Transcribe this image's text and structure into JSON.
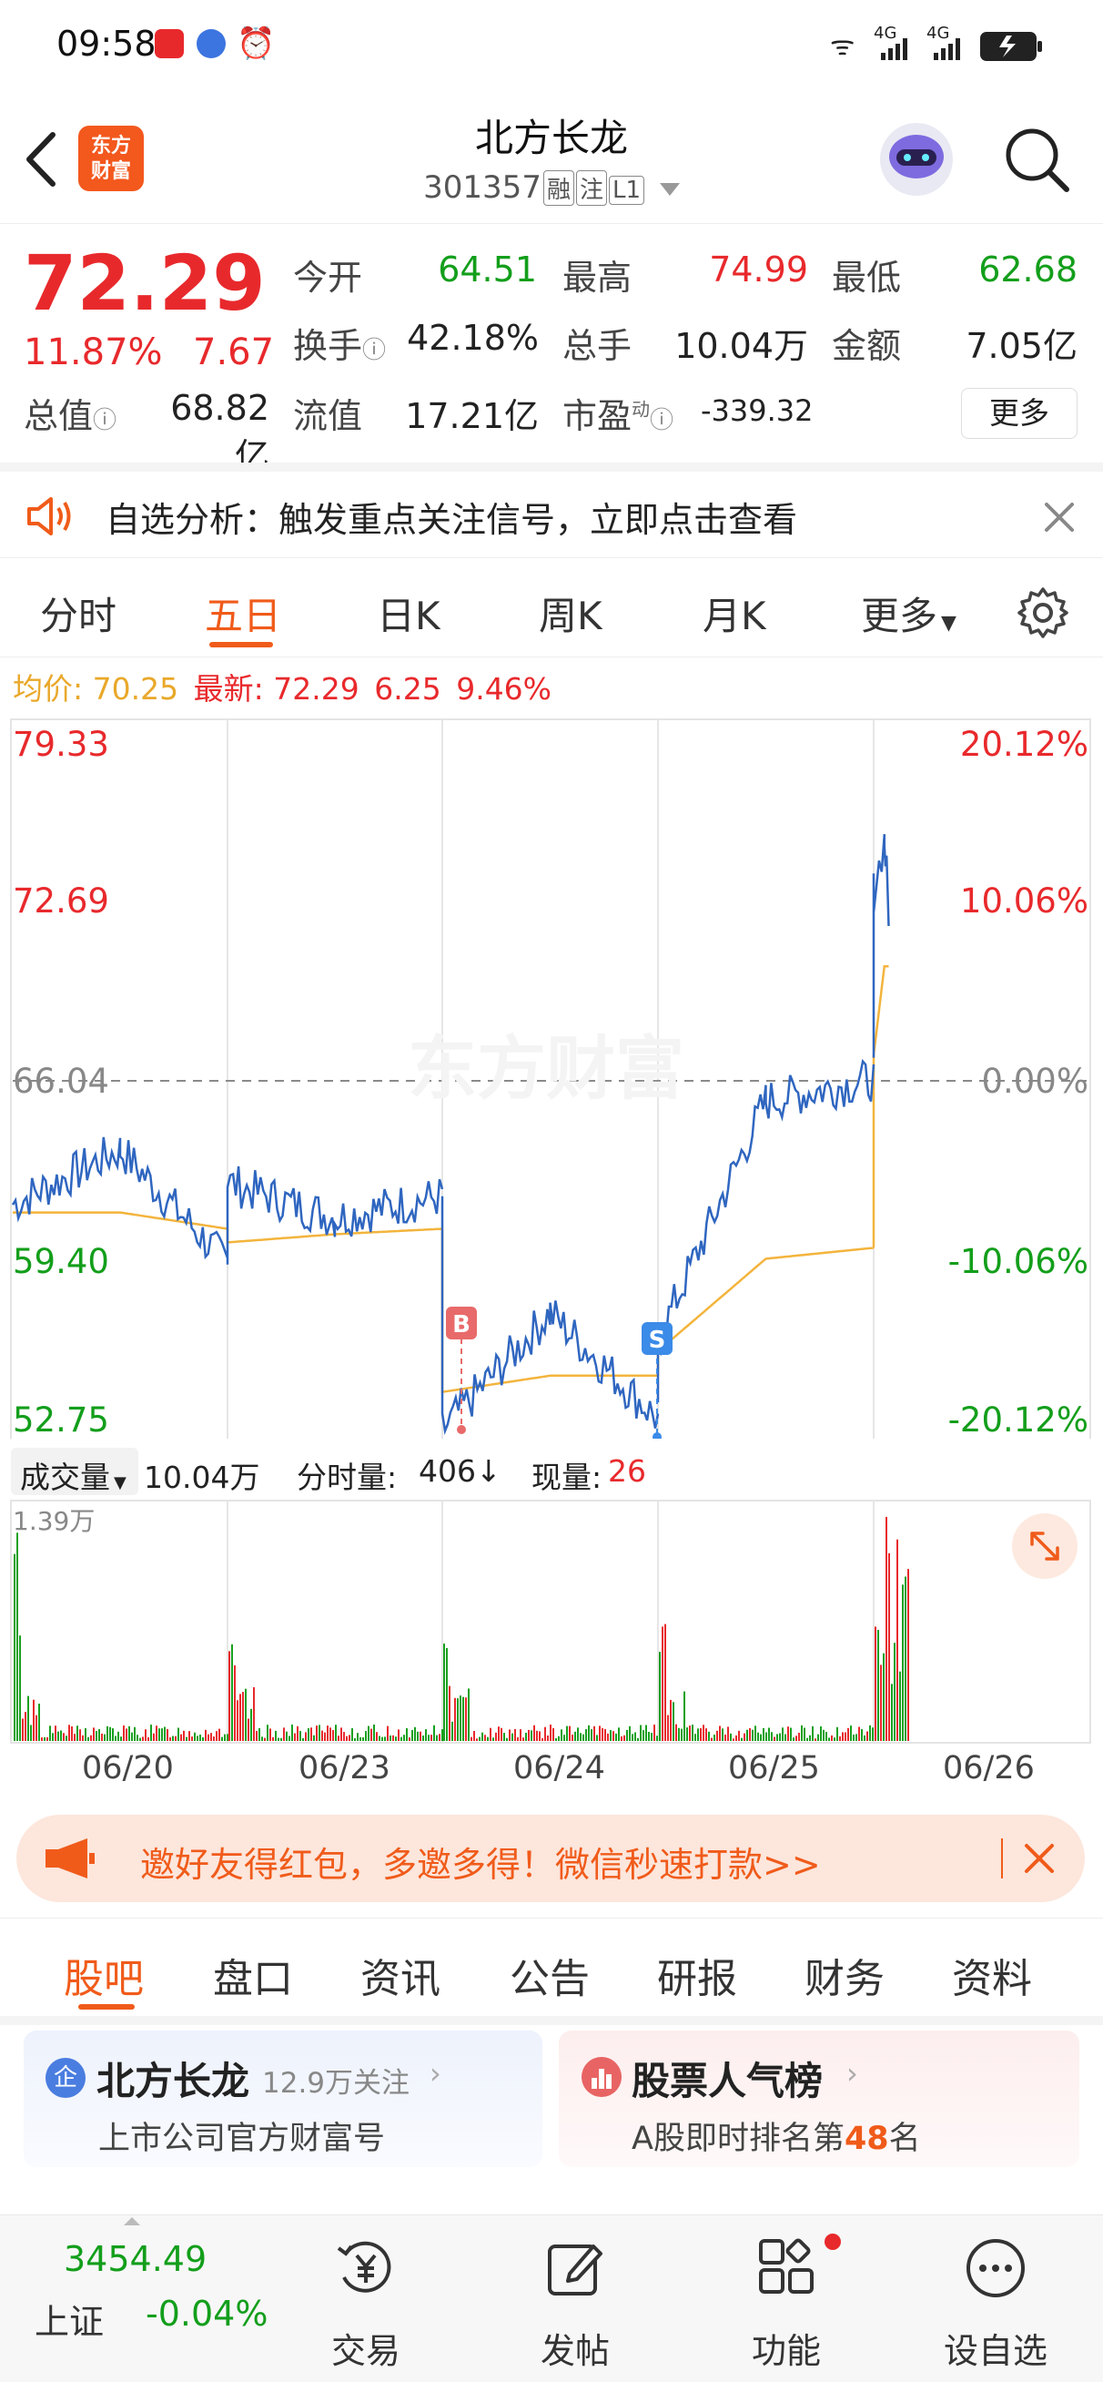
{
  "status_bar": {
    "time": "09:58",
    "net1": "4G",
    "net2": "4G"
  },
  "header": {
    "logo_text": "东方财富",
    "title": "北方长龙",
    "code": "301357",
    "tag_rong": "融",
    "tag_zhu": "注",
    "tag_level": "L1"
  },
  "quote": {
    "price": "72.29",
    "change_pct": "11.87%",
    "change": "7.67",
    "open_label": "今开",
    "open": "64.51",
    "high_label": "最高",
    "high": "74.99",
    "low_label": "最低",
    "low": "62.68",
    "turnover_label": "换手",
    "turnover": "42.18%",
    "volume_label": "总手",
    "volume": "10.04万",
    "amount_label": "金额",
    "amount": "7.05亿",
    "mktcap_label": "总值",
    "mktcap": "68.82亿",
    "float_label": "流值",
    "float": "17.21亿",
    "pe_label": "市盈",
    "pe_sup": "动",
    "pe": "-339.32",
    "more_label": "更多"
  },
  "notice": {
    "text": "自选分析：触发重点关注信号，立即点击查看"
  },
  "tabs": [
    "分时",
    "五日",
    "日K",
    "周K",
    "月K",
    "更多"
  ],
  "price_bar": {
    "avg_label": "均价:",
    "avg": "70.25",
    "last_label": "最新:",
    "last": "72.29",
    "chg": "6.25",
    "pct": "9.46%"
  },
  "chart_data": [
    {
      "type": "line",
      "title": "",
      "x_ticks": [
        "06/20",
        "06/23",
        "06/24",
        "06/25",
        "06/26"
      ],
      "ylim": [
        52.75,
        79.33
      ],
      "y_ticks_left": [
        "79.33",
        "72.69",
        "66.04",
        "59.40",
        "52.75"
      ],
      "y_ticks_right": [
        "20.12%",
        "10.06%",
        "0.00%",
        "-10.06%",
        "-20.12%"
      ],
      "reference_line": 66.04,
      "series": [],
      "x": [
        "06/20 open",
        "06/20 mid",
        "06/20 close",
        "06/23 open",
        "06/23 mid",
        "06/23 close",
        "06/24 open",
        "06/24 mid",
        "06/24 close",
        "06/25 open",
        "06/25 mid",
        "06/25 close",
        "06/26 open",
        "06/26 high",
        "06/26 now"
      ],
      "price": [
        61.5,
        63.5,
        59.3,
        62.3,
        61.0,
        61.8,
        53.2,
        57.5,
        53.6,
        56.5,
        65.3,
        66.1,
        73.0,
        74.9,
        72.3
      ],
      "avg": [
        61.2,
        61.2,
        60.6,
        60.1,
        60.4,
        60.6,
        54.6,
        55.2,
        55.2,
        56.1,
        59.5,
        59.9,
        67.0,
        70.25,
        70.25
      ],
      "markers": [
        {
          "label": "B",
          "x": "06/24 open"
        },
        {
          "label": "S",
          "x": "06/24 close"
        }
      ]
    },
    {
      "type": "bar",
      "title": "",
      "ylabel": "成交量",
      "y_max_label": "1.39万",
      "summary": {
        "total_label": "10.04万",
        "minute_label": "分时量:",
        "minute": "406",
        "current_label": "现量:",
        "current": "26"
      },
      "days": [
        "06/20",
        "06/23",
        "06/24",
        "06/25",
        "06/26"
      ],
      "spikes": [
        0.95,
        0.42,
        0.48,
        0.72,
        1.0
      ]
    }
  ],
  "volume_bar": {
    "selector": "成交量",
    "total": "10.04万",
    "minute_label": "分时量:",
    "minute": "406↓",
    "current_label": "现量:",
    "current": "26"
  },
  "banner": {
    "text": "邀好友得红包，多邀多得！微信秒速打款>>"
  },
  "bottom_tabs": [
    "股吧",
    "盘口",
    "资讯",
    "公告",
    "研报",
    "财务",
    "资料"
  ],
  "card_left": {
    "badge": "企",
    "title": "北方长龙",
    "followers": "12.9万关注",
    "sub": "上市公司官方财富号"
  },
  "card_right": {
    "title": "股票人气榜",
    "sub_pre": "A股即时排名第",
    "rank": "48",
    "sub_post": "名"
  },
  "bottom_nav": {
    "index_value": "3454.49",
    "index_name": "上证",
    "index_change": "-0.04%",
    "items": [
      "交易",
      "发帖",
      "功能",
      "设自选"
    ]
  },
  "colors": {
    "accent": "#f05b1a",
    "up": "#e8292c",
    "down": "#139e1b",
    "line": "#2f66c0",
    "avg": "#f3b43c"
  },
  "watermark": "东方财富"
}
